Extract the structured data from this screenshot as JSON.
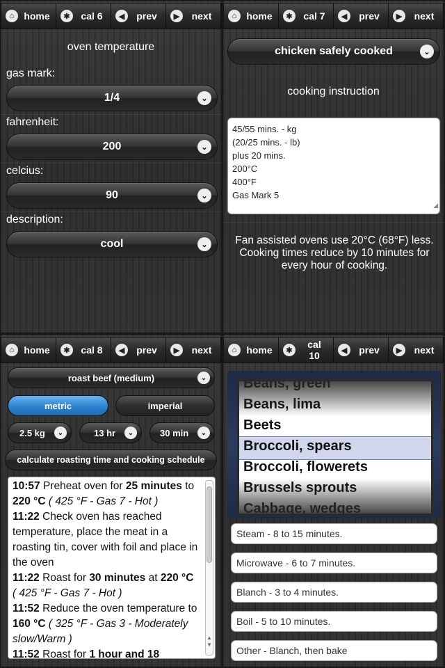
{
  "nav": {
    "home": "home",
    "prev": "prev",
    "next": "next",
    "cal1": "cal 6",
    "cal2": "cal 7",
    "cal3": "cal 8",
    "cal4": "cal 10"
  },
  "oven": {
    "title": "oven temperature",
    "gas_label": "gas mark:",
    "gas_value": "1/4",
    "fahr_label": "fahrenheit:",
    "fahr_value": "200",
    "cels_label": "celcius:",
    "cels_value": "90",
    "desc_label": "description:",
    "desc_value": "cool"
  },
  "chicken": {
    "select": "chicken safely cooked",
    "instruction_label": "cooking instruction",
    "lines": [
      "45/55 mins. - kg",
      "(20/25 mins. - lb)",
      "plus 20 mins.",
      "200°C",
      "400°F",
      "Gas Mark 5"
    ],
    "note": "Fan assisted ovens use 20°C (68°F) less. Cooking times reduce by 10 minutes for every hour of cooking."
  },
  "roast": {
    "select": "roast beef (medium)",
    "metric": "metric",
    "imperial": "imperial",
    "weight": "2.5 kg",
    "hours": "13 hr",
    "minutes": "30 min",
    "calc": "calculate roasting time and cooking schedule",
    "s1_time": "10:57",
    "s1_a": "Preheat oven for",
    "s1_b": "25 minutes",
    "s1_c": "to",
    "s1_temp": "220 °C",
    "s1_alt": "( 425 °F - Gas 7 - Hot )",
    "s2_time": "11:22",
    "s2_text": "Check oven has reached temperature, place the meat in a roasting tin, cover with foil and place in the oven",
    "s3_time": "11:22",
    "s3_a": "Roast for",
    "s3_b": "30 minutes",
    "s3_c": "at",
    "s3_temp": "220 °C",
    "s3_alt": "( 425 °F - Gas 7 - Hot )",
    "s4_time": "11:52",
    "s4_a": "Reduce the oven temperature to",
    "s4_temp": "160 °C",
    "s4_alt": "( 325 °F - Gas 3 - Moderately slow/Warm )",
    "s5_time": "11:52",
    "s5_a": "Roast for",
    "s5_b": "1 hour and 18"
  },
  "veg": {
    "items": [
      "Beans, green",
      "Beans, lima",
      "Beets",
      "Broccoli, spears",
      "Broccoli, flowerets",
      "Brussels sprouts",
      "Cabbage, wedges"
    ],
    "options": [
      "Steam - 8 to 15 minutes.",
      "Microwave - 6 to 7 minutes.",
      "Blanch - 3 to 4 minutes.",
      "Boil - 5 to 10 minutes.",
      "Other - Blanch, then bake"
    ]
  }
}
